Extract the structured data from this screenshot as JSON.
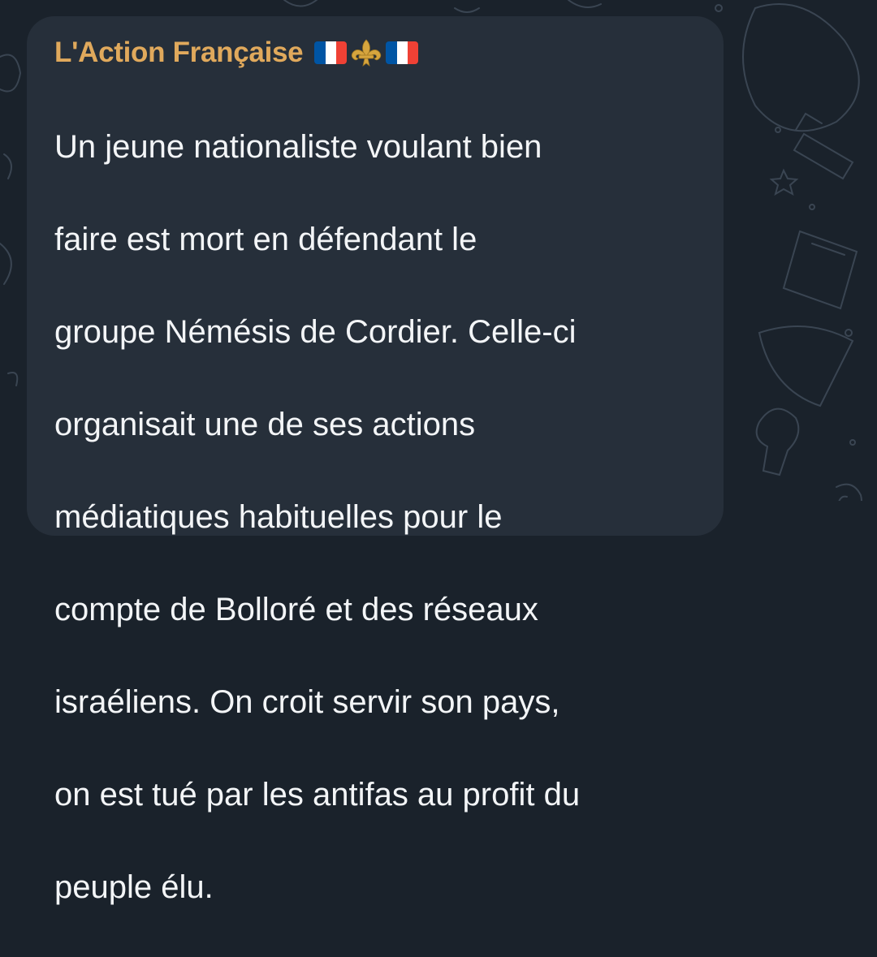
{
  "chat": {
    "sender_name": "L'Action Française",
    "sender_emojis": [
      {
        "icon": "french-flag",
        "colors": [
          "#0055a4",
          "#ffffff",
          "#ef4135"
        ]
      },
      {
        "icon": "fleur-de-lis",
        "color": "#d6a53e"
      },
      {
        "icon": "french-flag",
        "colors": [
          "#0055a4",
          "#ffffff",
          "#ef4135"
        ]
      }
    ],
    "message_lines": [
      "Un jeune nationaliste voulant bien",
      "faire est mort en défendant le",
      "groupe Némésis de Cordier. Celle-ci",
      "organisait une de ses actions",
      "médiatiques habituelles pour le",
      "compte de Bolloré et des réseaux",
      "israéliens. On croit servir son pays,",
      "on est tué par les antifas au profit du",
      "peuple élu."
    ]
  },
  "colors": {
    "background": "#1a222b",
    "bubble": "#262f3a",
    "sender_name": "#e0a95c",
    "message_text": "#f3f5f7"
  }
}
